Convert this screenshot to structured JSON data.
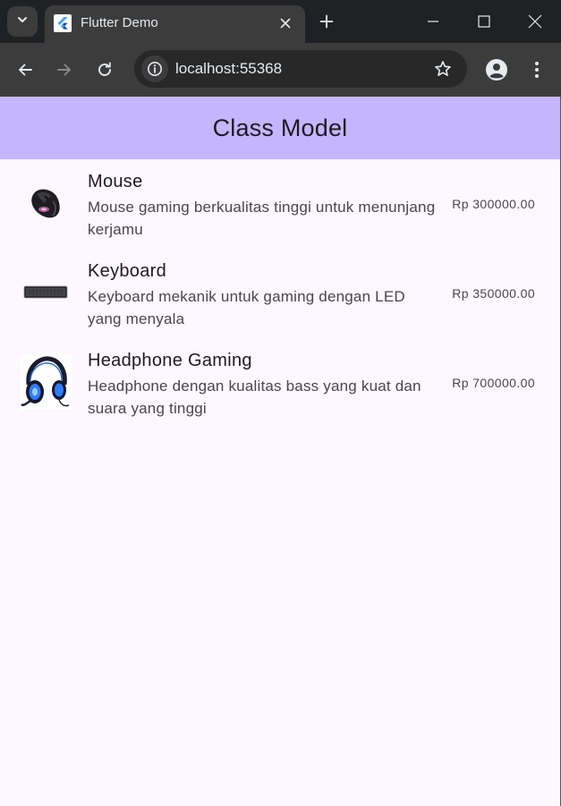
{
  "browser": {
    "tab_title": "Flutter Demo",
    "url": "localhost:55368",
    "icons": {
      "tab_search": "chevron-down-icon",
      "favicon": "flutter-logo-icon",
      "tab_close": "close-icon",
      "new_tab": "plus-icon",
      "minimize": "minimize-icon",
      "maximize": "maximize-icon",
      "close_window": "close-icon",
      "back": "arrow-left-icon",
      "forward": "arrow-right-icon",
      "reload": "reload-icon",
      "site_info": "info-icon",
      "bookmark": "star-icon",
      "profile": "account-icon",
      "menu": "more-vert-icon"
    }
  },
  "app": {
    "title": "Class Model",
    "appbar_color": "#c5b5ff",
    "background_color": "#fdf7ff",
    "products": [
      {
        "name": "Mouse",
        "description": "Mouse gaming berkualitas tinggi untuk menunjang kerjamu",
        "price": "Rp 300000.00",
        "image": "gaming-mouse"
      },
      {
        "name": "Keyboard",
        "description": "Keyboard mekanik untuk gaming dengan LED yang menyala",
        "price": "Rp 350000.00",
        "image": "mechanical-keyboard"
      },
      {
        "name": "Headphone Gaming",
        "description": "Headphone dengan kualitas bass yang kuat dan suara yang tinggi",
        "price": "Rp 700000.00",
        "image": "gaming-headset"
      }
    ]
  }
}
